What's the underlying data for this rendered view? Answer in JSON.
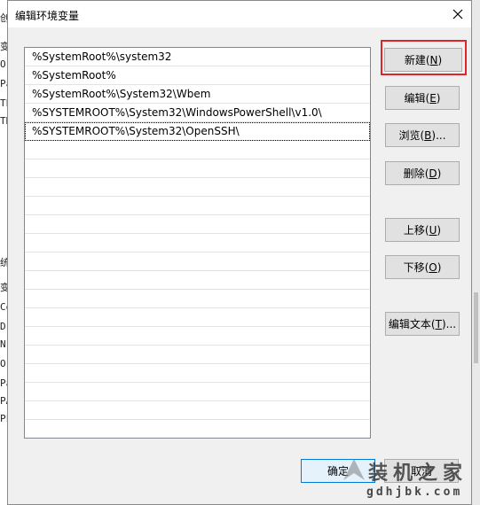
{
  "background_left_fragments": [
    "创",
    "变",
    "O",
    "Pa",
    "TE",
    "TN",
    "统",
    "变",
    "Co",
    "Dr",
    "N",
    "O",
    "Pa",
    "PA",
    "PF"
  ],
  "dialog": {
    "title": "编辑环境变量",
    "close_icon": "close-icon"
  },
  "paths": [
    "%SystemRoot%\\system32",
    "%SystemRoot%",
    "%SystemRoot%\\System32\\Wbem",
    "%SYSTEMROOT%\\System32\\WindowsPowerShell\\v1.0\\",
    "%SYSTEMROOT%\\System32\\OpenSSH\\"
  ],
  "selected_index": 4,
  "buttons": {
    "new": {
      "label": "新建",
      "key": "N"
    },
    "edit": {
      "label": "编辑",
      "key": "E"
    },
    "browse": {
      "label": "浏览",
      "key": "B",
      "suffix": "..."
    },
    "delete": {
      "label": "删除",
      "key": "D"
    },
    "move_up": {
      "label": "上移",
      "key": "U"
    },
    "move_down": {
      "label": "下移",
      "key": "O"
    },
    "edit_text": {
      "label": "编辑文本",
      "key": "T",
      "suffix": "..."
    },
    "ok": {
      "label": "确定"
    },
    "cancel": {
      "label": "取消"
    }
  },
  "highlight_color": "#e0242b",
  "watermark": {
    "line1": "装机之家",
    "line2": "gdhjbk.com"
  }
}
